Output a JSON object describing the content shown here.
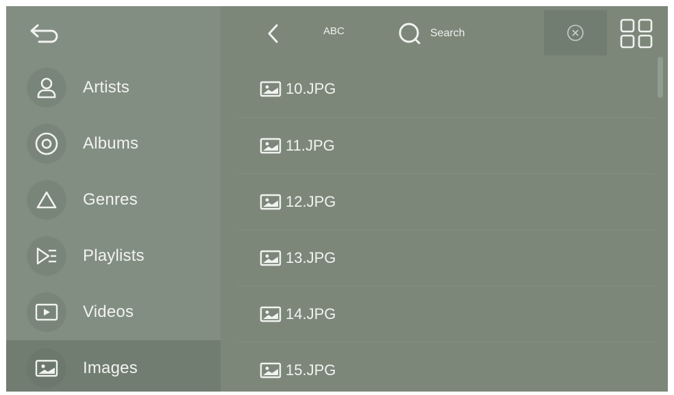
{
  "sidebar": {
    "back_icon": "return-arrow-icon",
    "items": [
      {
        "label": "Artists",
        "icon": "person-icon"
      },
      {
        "label": "Albums",
        "icon": "disc-icon"
      },
      {
        "label": "Genres",
        "icon": "triangle-icon"
      },
      {
        "label": "Playlists",
        "icon": "playlist-icon"
      },
      {
        "label": "Videos",
        "icon": "video-icon"
      },
      {
        "label": "Images",
        "icon": "image-icon",
        "selected": true
      }
    ]
  },
  "topbar": {
    "back_icon": "chevron-left-icon",
    "abc_label": "ABC",
    "search_placeholder": "Search",
    "clear_icon": "clear-circle-icon",
    "grid_icon": "grid-view-icon"
  },
  "files": [
    {
      "name": "10.JPG"
    },
    {
      "name": "11.JPG"
    },
    {
      "name": "12.JPG"
    },
    {
      "name": "13.JPG"
    },
    {
      "name": "14.JPG"
    },
    {
      "name": "15.JPG"
    }
  ],
  "colors": {
    "background": "#7c877a",
    "sidebar": "#838e82",
    "selected": "#727d71",
    "text": "#f1f3f0"
  }
}
